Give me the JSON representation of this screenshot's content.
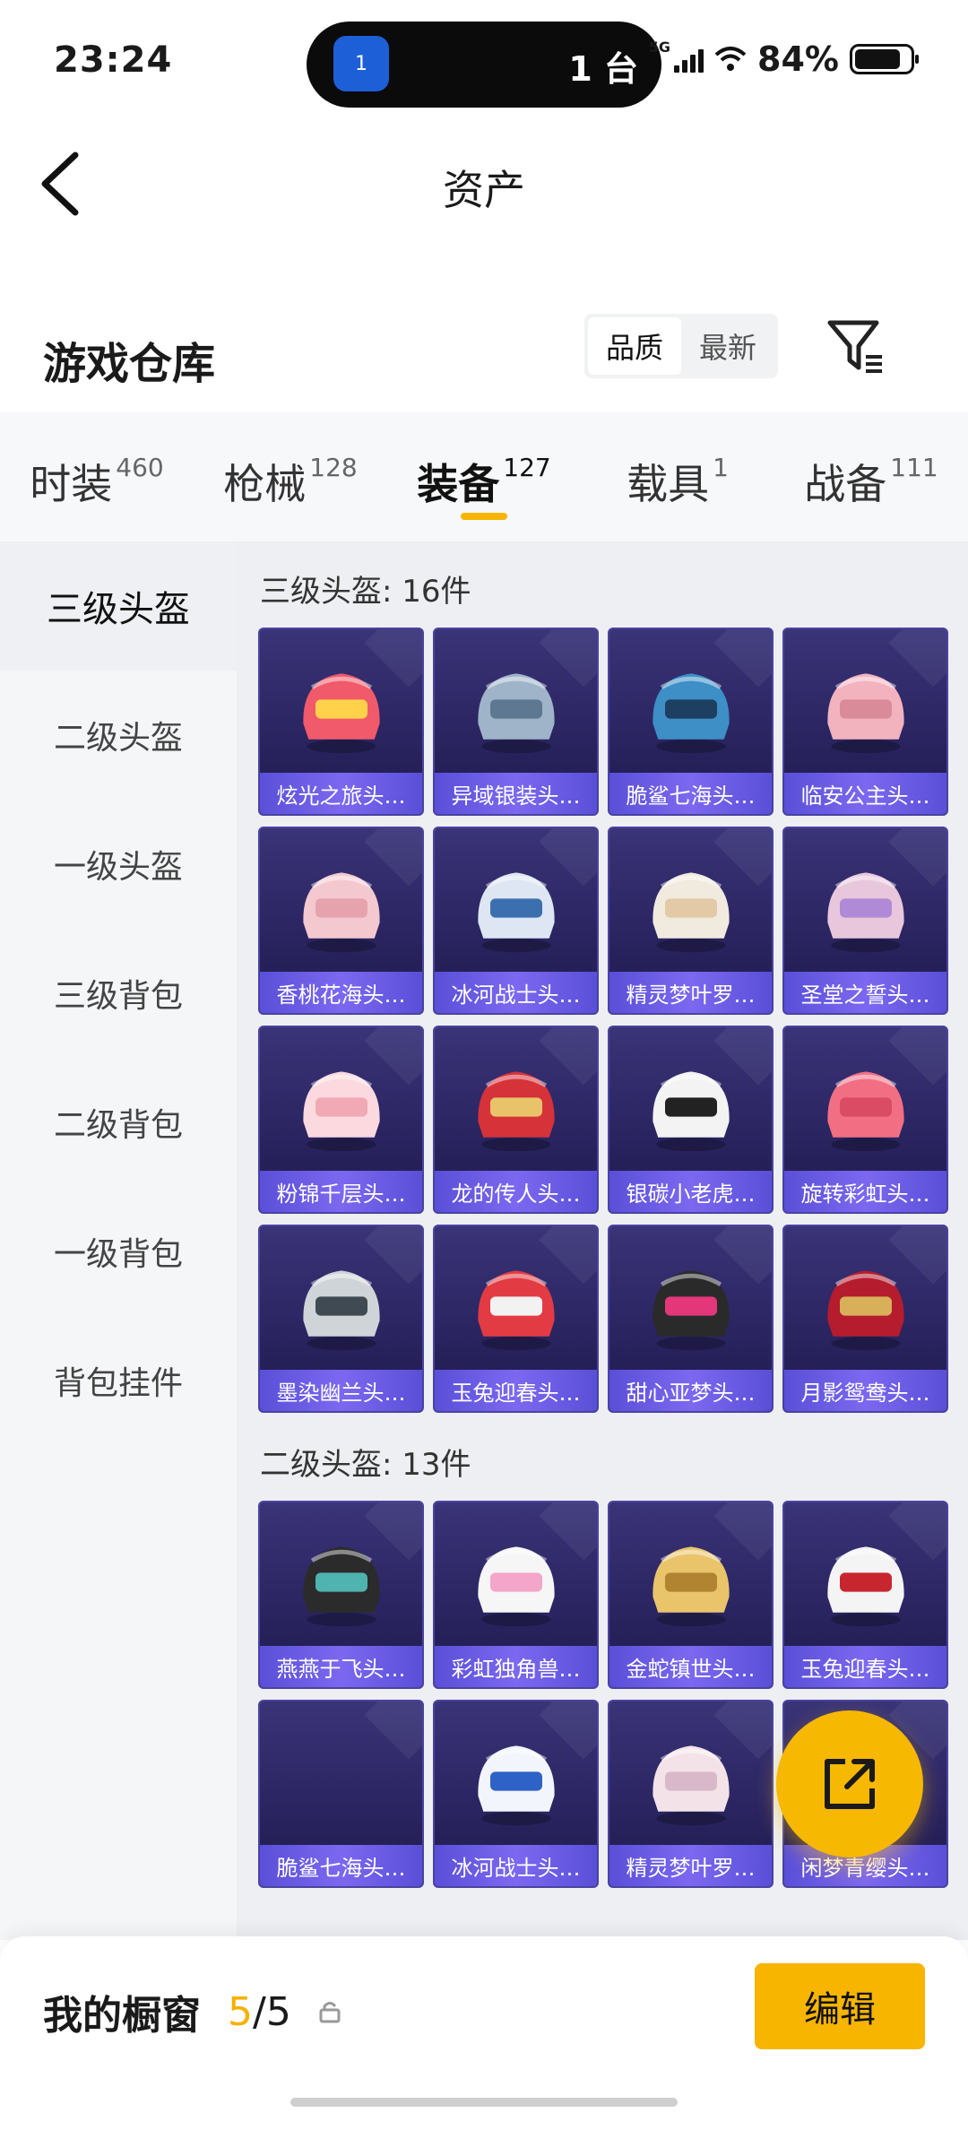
{
  "status_bar": {
    "time": "23:24",
    "island_text": "1 台",
    "island_app_badge": "1",
    "network": "5G",
    "battery": "84%"
  },
  "header": {
    "title": "资产"
  },
  "warehouse": {
    "title": "游戏仓库",
    "sort_options": [
      "品质",
      "最新"
    ],
    "sort_selected": "品质"
  },
  "tabs": [
    {
      "label": "时装",
      "count": "460"
    },
    {
      "label": "枪械",
      "count": "128"
    },
    {
      "label": "装备",
      "count": "127"
    },
    {
      "label": "载具",
      "count": "1"
    },
    {
      "label": "战备",
      "count": "111"
    }
  ],
  "active_tab": "装备",
  "sidebar": [
    "三级头盔",
    "二级头盔",
    "一级头盔",
    "三级背包",
    "二级背包",
    "一级背包",
    "背包挂件"
  ],
  "sidebar_active": "三级头盔",
  "groups": [
    {
      "title": "三级头盔: 16件",
      "items": [
        "炫光之旅头…",
        "异域银装头…",
        "脆鲨七海头…",
        "临安公主头…",
        "香桃花海头…",
        "冰河战士头…",
        "精灵梦叶罗…",
        "圣堂之誓头…",
        "粉锦千层头…",
        "龙的传人头…",
        "银碳小老虎…",
        "旋转彩虹头…",
        "墨染幽兰头…",
        "玉兔迎春头…",
        "甜心亚梦头…",
        "月影鸳鸯头…"
      ]
    },
    {
      "title": "二级头盔: 13件",
      "items": [
        "燕燕于飞头…",
        "彩虹独角兽…",
        "金蛇镇世头…",
        "玉兔迎春头…",
        "脆鲨七海头…",
        "冰河战士头…",
        "精灵梦叶罗…",
        "闲梦青缨头…"
      ]
    }
  ],
  "bottom": {
    "showcase_label": "我的橱窗",
    "showcase_used": "5",
    "showcase_total": "/5",
    "edit_label": "编辑"
  },
  "colors": {
    "accent": "#f7b500",
    "card_bg": "#2b2562",
    "card_label": "#6a5ae6"
  }
}
